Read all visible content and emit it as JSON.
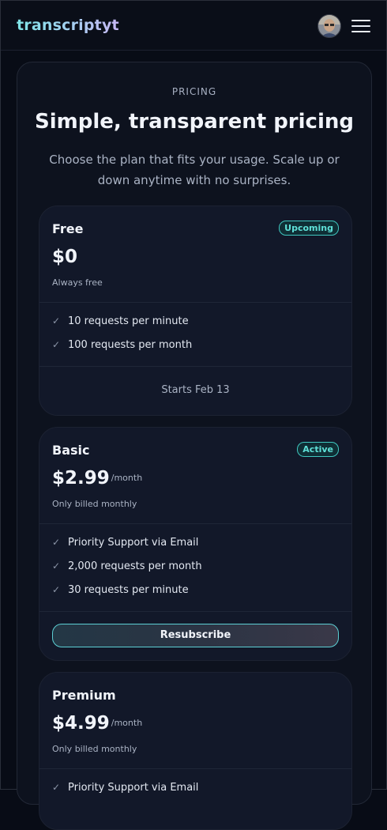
{
  "header": {
    "logo": "transcriptyt",
    "menu_icon": "hamburger-menu-icon",
    "avatar_icon": "user-avatar"
  },
  "pricing": {
    "eyebrow": "PRICING",
    "title": "Simple, transparent pricing",
    "subtitle": "Choose the plan that fits your usage. Scale up or down anytime with no surprises."
  },
  "plans": [
    {
      "name": "Free",
      "badge": "Upcoming",
      "price": "$0",
      "period": "",
      "billing": "Always free",
      "features": [
        "10 requests per minute",
        "100 requests per month"
      ],
      "footer": "Starts Feb 13"
    },
    {
      "name": "Basic",
      "badge": "Active",
      "price": "$2.99",
      "period": "/month",
      "billing": "Only billed monthly",
      "features": [
        "Priority Support via Email",
        "2,000 requests per month",
        "30 requests per minute"
      ],
      "action": "Resubscribe"
    },
    {
      "name": "Premium",
      "price": "$4.99",
      "period": "/month",
      "billing": "Only billed monthly",
      "features": [
        "Priority Support via Email"
      ]
    }
  ],
  "colors": {
    "background": "#080c16",
    "card": "#121829",
    "accent": "#5fe0d8",
    "badge_bg": "#0f2e35"
  },
  "icons": {
    "check": "check-icon"
  }
}
